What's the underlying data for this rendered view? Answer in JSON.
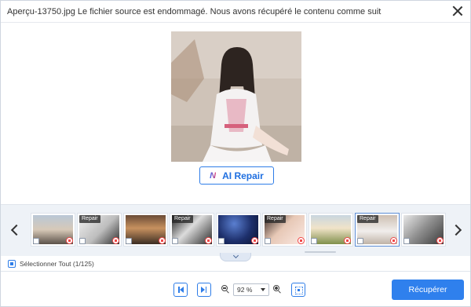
{
  "window": {
    "title": "Aperçu-13750.jpg Le fichier source est endommagé. Nous avons récupéré le contenu comme suit"
  },
  "preview": {
    "ai_repair_logo": "N",
    "ai_repair_label": "AI Repair"
  },
  "thumbnails": [
    {
      "badge": "",
      "selected": false
    },
    {
      "badge": "Repair",
      "selected": false
    },
    {
      "badge": "",
      "selected": false
    },
    {
      "badge": "Repair",
      "selected": false
    },
    {
      "badge": "",
      "selected": false
    },
    {
      "badge": "Repair",
      "selected": false
    },
    {
      "badge": "",
      "selected": false
    },
    {
      "badge": "Repair",
      "selected": true
    },
    {
      "badge": "",
      "selected": false
    }
  ],
  "selection": {
    "label": "Sélectionner Tout (1/125)"
  },
  "toolbar": {
    "zoom_value": "92 %",
    "recover_label": "Récupérer"
  },
  "icons": {
    "close": "close-icon",
    "prev_thumb": "chevron-left-icon",
    "next_thumb": "chevron-right-icon",
    "first": "skip-first-icon",
    "last": "skip-last-icon",
    "zoom_out": "zoom-out-icon",
    "zoom_in": "zoom-in-icon",
    "fit": "fit-screen-icon",
    "delete": "trash-icon",
    "collapse": "chevron-down-icon"
  },
  "colors": {
    "accent": "#2f80ed",
    "delete": "#f14848",
    "strip_bg": "#eef2f7"
  }
}
